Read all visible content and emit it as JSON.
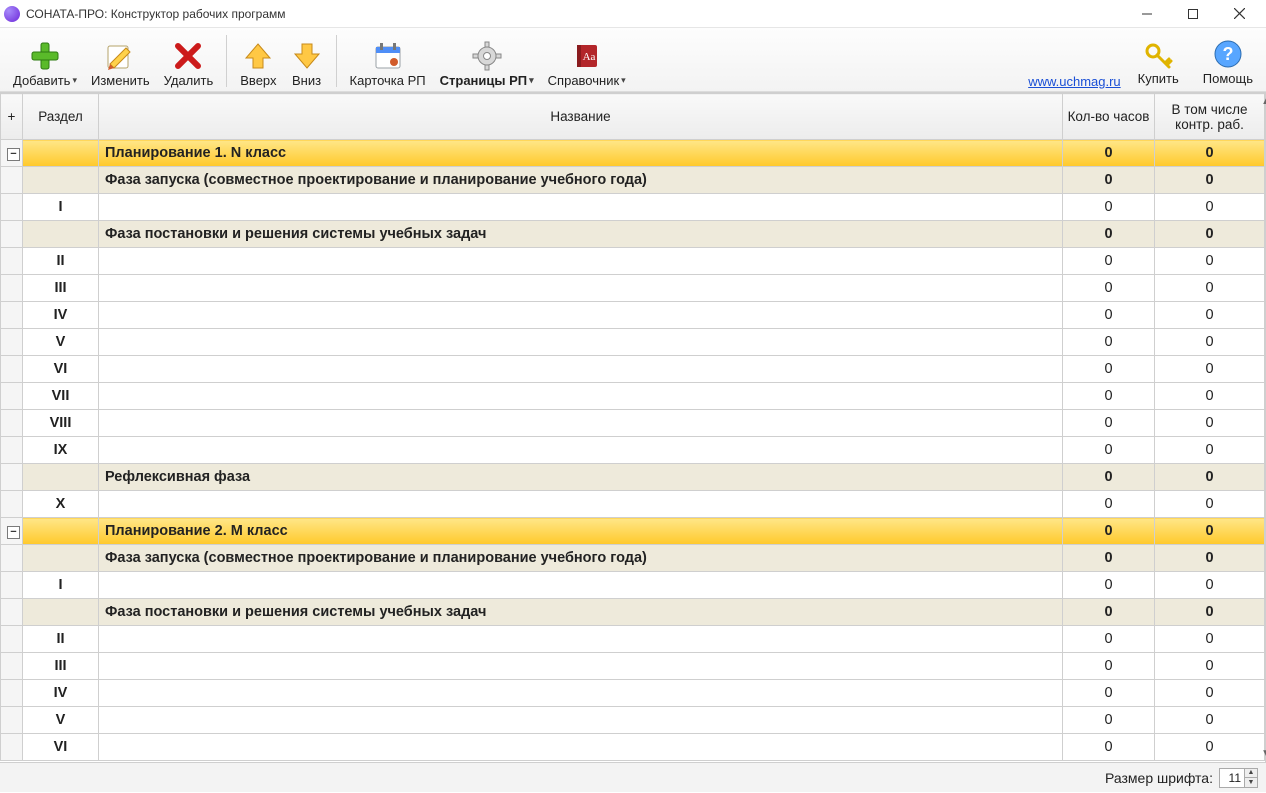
{
  "window": {
    "title": "СОНАТА-ПРО: Конструктор рабочих программ"
  },
  "link": {
    "text": "www.uchmag.ru"
  },
  "toolbar": {
    "add": "Добавить",
    "edit": "Изменить",
    "delete": "Удалить",
    "up": "Вверх",
    "down": "Вниз",
    "card": "Карточка РП",
    "pages": "Страницы РП",
    "ref": "Справочник",
    "buy": "Купить",
    "help": "Помощь"
  },
  "grid": {
    "headers": {
      "plus": "+",
      "section": "Раздел",
      "name": "Название",
      "hours": "Кол-во часов",
      "ctrl": "В том числе контр. раб."
    },
    "rows": [
      {
        "type": "plan",
        "toggle": "−",
        "section": "",
        "name": "Планирование 1. N класс",
        "hours": "0",
        "ctrl": "0"
      },
      {
        "type": "phase",
        "section": "",
        "name": "Фаза запуска (совместное проектирование и  планирование учебного года)",
        "hours": "0",
        "ctrl": "0"
      },
      {
        "type": "row",
        "section": "I",
        "name": "",
        "hours": "0",
        "ctrl": "0"
      },
      {
        "type": "phase",
        "section": "",
        "name": "Фаза постановки и решения системы учебных задач",
        "hours": "0",
        "ctrl": "0"
      },
      {
        "type": "row",
        "section": "II",
        "name": "",
        "hours": "0",
        "ctrl": "0"
      },
      {
        "type": "row",
        "section": "III",
        "name": "",
        "hours": "0",
        "ctrl": "0"
      },
      {
        "type": "row",
        "section": "IV",
        "name": "",
        "hours": "0",
        "ctrl": "0"
      },
      {
        "type": "row",
        "section": "V",
        "name": "",
        "hours": "0",
        "ctrl": "0"
      },
      {
        "type": "row",
        "section": "VI",
        "name": "",
        "hours": "0",
        "ctrl": "0"
      },
      {
        "type": "row",
        "section": "VII",
        "name": "",
        "hours": "0",
        "ctrl": "0"
      },
      {
        "type": "row",
        "section": "VIII",
        "name": "",
        "hours": "0",
        "ctrl": "0"
      },
      {
        "type": "row",
        "section": "IX",
        "name": "",
        "hours": "0",
        "ctrl": "0"
      },
      {
        "type": "phase",
        "section": "",
        "name": "Рефлексивная фаза",
        "hours": "0",
        "ctrl": "0"
      },
      {
        "type": "row",
        "section": "X",
        "name": "",
        "hours": "0",
        "ctrl": "0"
      },
      {
        "type": "plan",
        "toggle": "−",
        "section": "",
        "name": "Планирование 2. M класс",
        "hours": "0",
        "ctrl": "0"
      },
      {
        "type": "phase",
        "section": "",
        "name": "Фаза запуска (совместное проектирование и  планирование учебного года)",
        "hours": "0",
        "ctrl": "0"
      },
      {
        "type": "row",
        "section": "I",
        "name": "",
        "hours": "0",
        "ctrl": "0"
      },
      {
        "type": "phase",
        "section": "",
        "name": "Фаза постановки и решения системы учебных задач",
        "hours": "0",
        "ctrl": "0"
      },
      {
        "type": "row",
        "section": "II",
        "name": "",
        "hours": "0",
        "ctrl": "0"
      },
      {
        "type": "row",
        "section": "III",
        "name": "",
        "hours": "0",
        "ctrl": "0"
      },
      {
        "type": "row",
        "section": "IV",
        "name": "",
        "hours": "0",
        "ctrl": "0"
      },
      {
        "type": "row",
        "section": "V",
        "name": "",
        "hours": "0",
        "ctrl": "0"
      },
      {
        "type": "row",
        "section": "VI",
        "name": "",
        "hours": "0",
        "ctrl": "0"
      }
    ]
  },
  "statusbar": {
    "font_label": "Размер шрифта:",
    "font_value": "11"
  }
}
